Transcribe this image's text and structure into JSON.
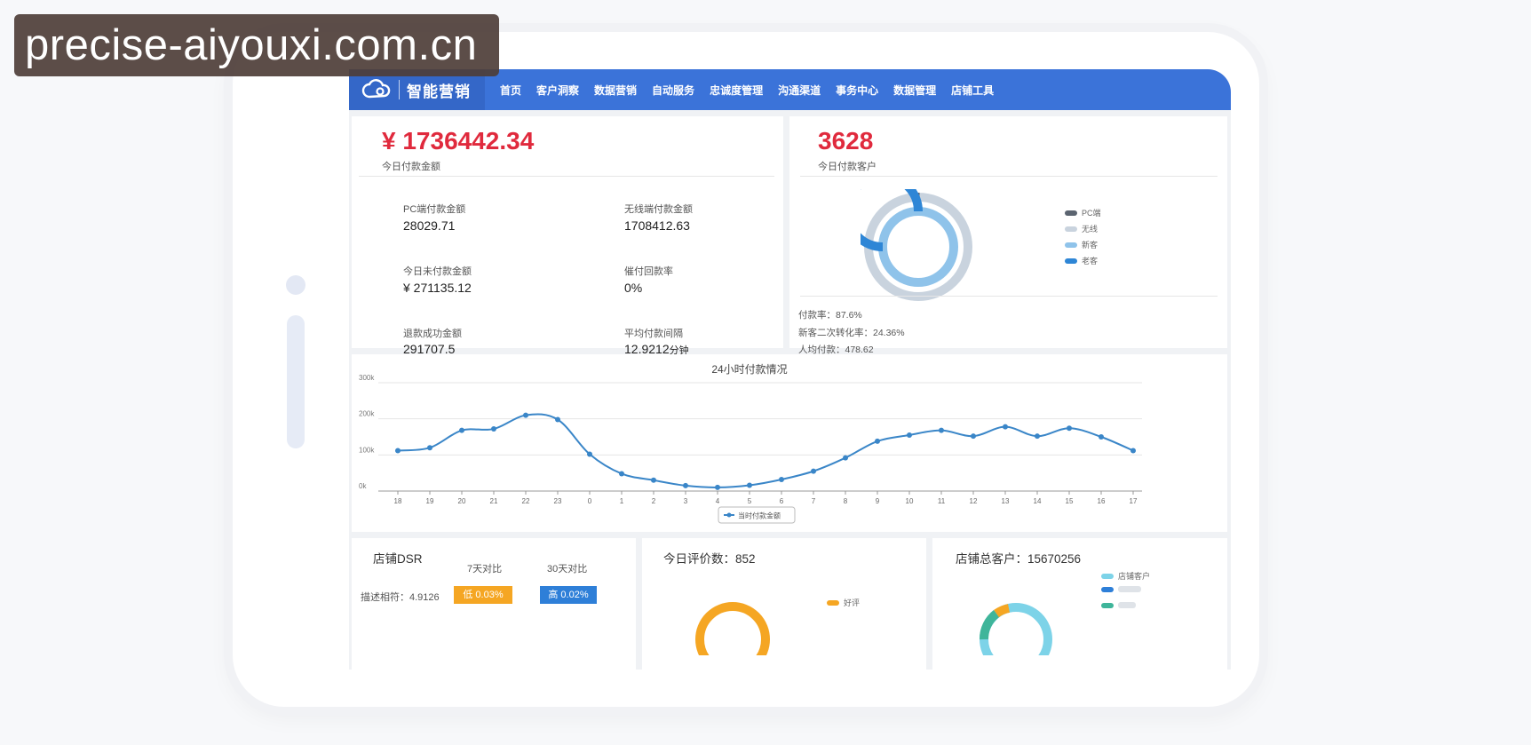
{
  "watermark": "precise-aiyouxi.com.cn",
  "brand": {
    "name": "智能营销",
    "logo_icon": "cloud-logo-icon"
  },
  "nav": [
    "首页",
    "客户洞察",
    "数据营销",
    "自动服务",
    "忠诚度管理",
    "沟通渠道",
    "事务中心",
    "数据管理",
    "店铺工具"
  ],
  "payment": {
    "amount": "¥ 1736442.34",
    "amount_label": "今日付款金额",
    "metrics": [
      {
        "label": "PC端付款金额",
        "value": "28029.71"
      },
      {
        "label": "无线端付款金额",
        "value": "1708412.63"
      },
      {
        "label": "今日未付款金额",
        "value": "¥ 271135.12"
      },
      {
        "label": "催付回款率",
        "value": "0%"
      },
      {
        "label": "退款成功金额",
        "value": "291707.5"
      },
      {
        "label": "平均付款间隔",
        "value": "12.9212",
        "unit": "分钟"
      }
    ]
  },
  "customers": {
    "count": "3628",
    "count_label": "今日付款客户",
    "legend": [
      {
        "label": "PC端",
        "color": "#5b6470"
      },
      {
        "label": "无线",
        "color": "#c9d3de"
      },
      {
        "label": "新客",
        "color": "#8fc3ea"
      },
      {
        "label": "老客",
        "color": "#2e86d6"
      }
    ],
    "stats": [
      "付款率：87.6%",
      "新客二次转化率：24.36%",
      "人均付款：478.62"
    ]
  },
  "chart_data": {
    "type": "line",
    "title": "24小时付款情况",
    "categories": [
      "18",
      "19",
      "20",
      "21",
      "22",
      "23",
      "0",
      "1",
      "2",
      "3",
      "4",
      "5",
      "6",
      "7",
      "8",
      "9",
      "10",
      "11",
      "12",
      "13",
      "14",
      "15",
      "16",
      "17"
    ],
    "series": [
      {
        "name": "当时付款金额",
        "color": "#3a86c8",
        "values": [
          112,
          120,
          168,
          172,
          210,
          198,
          102,
          48,
          30,
          15,
          10,
          16,
          32,
          55,
          92,
          138,
          155,
          168,
          152,
          178,
          152,
          174,
          150,
          112
        ]
      }
    ],
    "y_ticks": [
      "0k",
      "100k",
      "200k",
      "300k"
    ],
    "ylim": [
      0,
      300
    ],
    "grid": true,
    "legend": "bottom"
  },
  "dsr": {
    "title": "店铺DSR",
    "col1": "7天对比",
    "col2": "30天对比",
    "row_label": "描述相符：4.9126",
    "badge1": "低 0.03%",
    "badge2": "高 0.02%"
  },
  "reviews": {
    "title": "今日评价数：852",
    "legend_label": "好评"
  },
  "shop_customers": {
    "title": "店铺总客户：15670256",
    "legend_label": "店铺客户"
  }
}
